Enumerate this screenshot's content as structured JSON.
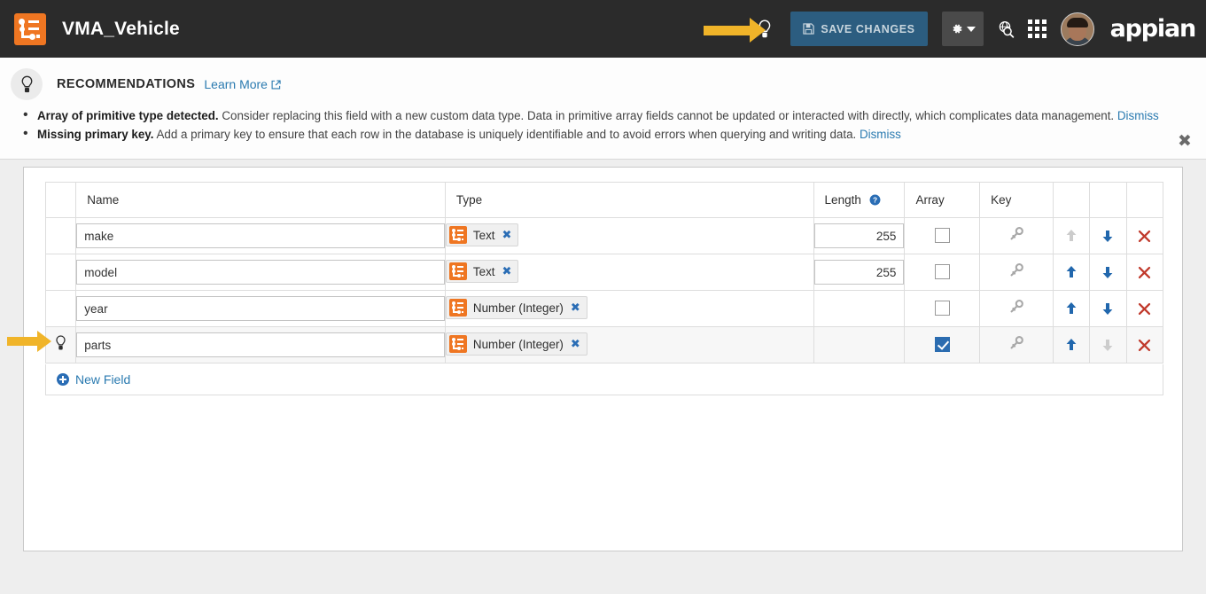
{
  "header": {
    "app_title": "VMA_Vehicle",
    "logo_icon": "data-type-icon",
    "bulb_icon": "lightbulb-icon",
    "save_label": "SAVE CHANGES",
    "save_icon": "floppy-disk-icon",
    "gear_icon": "gear-icon",
    "caret_icon": "chevron-down-icon",
    "search_icon": "globe-search-icon",
    "apps_icon": "app-grid-icon",
    "avatar_icon": "user-avatar",
    "brand": "appian"
  },
  "recommendations": {
    "bulb_icon": "lightbulb-icon",
    "title": "RECOMMENDATIONS",
    "learn_more": "Learn More",
    "external_icon": "external-link-icon",
    "close_icon": "close-icon",
    "items": [
      {
        "bold": "Array of primitive type detected.",
        "text": " Consider replacing this field with a new custom data type. Data in primitive array fields cannot be updated or interacted with directly, which complicates data management. ",
        "dismiss": "Dismiss"
      },
      {
        "bold": "Missing primary key.",
        "text": " Add a primary key to ensure that each row in the database is uniquely identifiable and to avoid errors when querying and writing data. ",
        "dismiss": "Dismiss"
      }
    ]
  },
  "table": {
    "columns": {
      "bulb": "",
      "name": "Name",
      "type": "Type",
      "length": "Length",
      "length_help_icon": "help-icon",
      "array": "Array",
      "key": "Key"
    },
    "rows": [
      {
        "bulb": false,
        "name": "make",
        "type": "Text",
        "length": "255",
        "has_length": true,
        "array": false,
        "key_icon": "key-icon",
        "up_enabled": false,
        "down_enabled": true,
        "highlighted": false
      },
      {
        "bulb": false,
        "name": "model",
        "type": "Text",
        "length": "255",
        "has_length": true,
        "array": false,
        "key_icon": "key-icon",
        "up_enabled": true,
        "down_enabled": true,
        "highlighted": false
      },
      {
        "bulb": false,
        "name": "year",
        "type": "Number (Integer)",
        "length": "",
        "has_length": false,
        "array": false,
        "key_icon": "key-icon",
        "up_enabled": true,
        "down_enabled": true,
        "highlighted": false
      },
      {
        "bulb": true,
        "name": "parts",
        "type": "Number (Integer)",
        "length": "",
        "has_length": false,
        "array": true,
        "key_icon": "key-icon",
        "up_enabled": true,
        "down_enabled": false,
        "highlighted": true
      }
    ],
    "new_field_label": "New Field",
    "new_field_icon": "plus-circle-icon",
    "remove_icon": "remove-x-icon",
    "move_up_icon": "arrow-up-icon",
    "move_down_icon": "arrow-down-icon"
  },
  "annotations": [
    {
      "name": "header-arrow-annotation",
      "icon": "arrow-right-annotation"
    },
    {
      "name": "row-arrow-annotation",
      "icon": "arrow-right-annotation"
    }
  ],
  "colors": {
    "brand_orange": "#ef7622",
    "header_bg": "#2b2b2b",
    "save_btn": "#2c5d80",
    "link_blue": "#2a7ab0",
    "annotation_yellow": "#f0b429",
    "checkbox_blue": "#2b6cb0",
    "delete_red": "#c0392b"
  }
}
